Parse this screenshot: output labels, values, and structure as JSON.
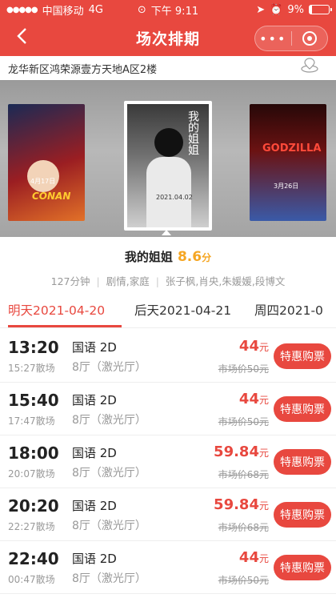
{
  "status_bar": {
    "carrier": "中国移动",
    "network": "4G",
    "time": "下午 9:11",
    "battery": "9%"
  },
  "nav": {
    "back_icon": "chevron-left-icon",
    "title": "场次排期",
    "more_icon": "more-dots-icon",
    "close_icon": "target-close-icon"
  },
  "address": "龙华新区鸿荣源壹方天地A区2楼",
  "movie": {
    "title": "我的姐姐",
    "score": "8.6",
    "score_unit": "分",
    "duration": "127分钟",
    "genre": "剧情,家庭",
    "cast": "张子枫,肖央,朱媛媛,段博文"
  },
  "posters": [
    {
      "date": "4月17日",
      "logo": "CONAN"
    },
    {
      "title": "我的姐姐",
      "date": "2021.04.02"
    },
    {
      "logo": "GODZILLA",
      "date": "3月26日"
    }
  ],
  "date_tabs": [
    {
      "label": "明天2021-04-20",
      "active": true
    },
    {
      "label": "后天2021-04-21",
      "active": false
    },
    {
      "label": "周四2021-0",
      "active": false
    }
  ],
  "shows": [
    {
      "start": "13:20",
      "end": "15:27散场",
      "lang": "国语 2D",
      "hall": "8厅（激光厅）",
      "price": "44",
      "unit": "元",
      "market": "市场价50元",
      "buy": "特惠购票"
    },
    {
      "start": "15:40",
      "end": "17:47散场",
      "lang": "国语 2D",
      "hall": "8厅（激光厅）",
      "price": "44",
      "unit": "元",
      "market": "市场价50元",
      "buy": "特惠购票"
    },
    {
      "start": "18:00",
      "end": "20:07散场",
      "lang": "国语 2D",
      "hall": "8厅（激光厅）",
      "price": "59.84",
      "unit": "元",
      "market": "市场价68元",
      "buy": "特惠购票"
    },
    {
      "start": "20:20",
      "end": "22:27散场",
      "lang": "国语 2D",
      "hall": "8厅（激光厅）",
      "price": "59.84",
      "unit": "元",
      "market": "市场价68元",
      "buy": "特惠购票"
    },
    {
      "start": "22:40",
      "end": "00:47散场",
      "lang": "国语 2D",
      "hall": "8厅（激光厅）",
      "price": "44",
      "unit": "元",
      "market": "市场价50元",
      "buy": "特惠购票"
    }
  ],
  "colors": {
    "brand": "#e8483f",
    "score": "#f5a623"
  }
}
